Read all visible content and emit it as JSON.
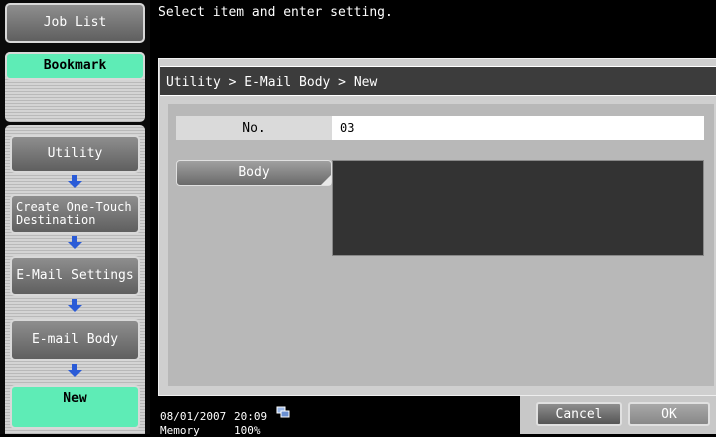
{
  "message": "Select item and enter setting.",
  "breadcrumb": "Utility > E-Mail Body > New",
  "left_panel": {
    "job_list": "Job List",
    "bookmark": "Bookmark",
    "nav": [
      "Utility",
      "Create One-Touch Destination",
      "E-Mail Settings",
      "E-mail Body",
      "New"
    ]
  },
  "form": {
    "no_label": "No.",
    "no_value": "03",
    "body_label": "Body",
    "body_value": ""
  },
  "status": {
    "date": "08/01/2007",
    "time": "20:09",
    "memory_label": "Memory",
    "memory_value": "100%"
  },
  "buttons": {
    "cancel": "Cancel",
    "ok": "OK"
  },
  "colors": {
    "highlight_green": "#5eecb6",
    "arrow_blue": "#2a5bd7"
  }
}
